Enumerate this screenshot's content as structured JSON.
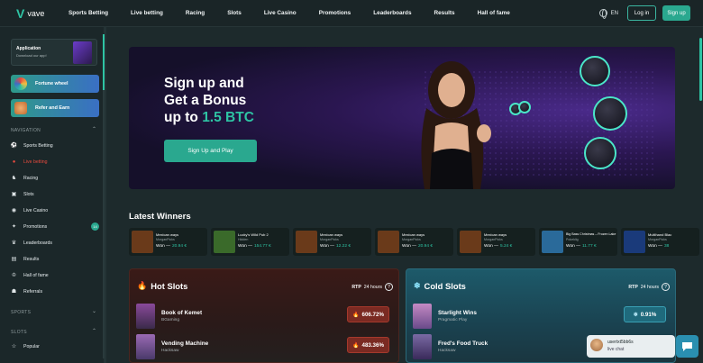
{
  "brand": {
    "name": "vave",
    "accent": "#2ec4a4"
  },
  "nav": [
    "Sports Betting",
    "Live betting",
    "Racing",
    "Slots",
    "Live Casino",
    "Promotions",
    "Leaderboards",
    "Results",
    "Hall of fame"
  ],
  "header": {
    "language": "EN",
    "login_label": "Log in",
    "signup_label": "Sign up"
  },
  "sidebar": {
    "app_title": "Application",
    "app_subtitle": "Download our app!",
    "promo_tiles": [
      "Fortune wheel",
      "Refer and Earn"
    ],
    "nav_label": "NAVIGATION",
    "items": [
      {
        "label": "Sports Betting",
        "icon": "soccer-ball-icon"
      },
      {
        "label": "Live betting",
        "icon": "live-icon"
      },
      {
        "label": "Racing",
        "icon": "horse-icon"
      },
      {
        "label": "Slots",
        "icon": "slot-icon"
      },
      {
        "label": "Live Casino",
        "icon": "chip-icon"
      },
      {
        "label": "Promotions",
        "icon": "gift-icon",
        "badge": "14"
      },
      {
        "label": "Leaderboards",
        "icon": "trophy-icon"
      },
      {
        "label": "Results",
        "icon": "results-icon"
      },
      {
        "label": "Hall of fame",
        "icon": "crown-icon"
      },
      {
        "label": "Referrals",
        "icon": "people-icon"
      }
    ],
    "sports_label": "SPORTS",
    "slots_label": "SLOTS",
    "slots_items": [
      {
        "label": "Popular",
        "icon": "star-icon"
      }
    ]
  },
  "hero": {
    "line1": "Sign up and",
    "line2": "Get a Bonus",
    "line3_prefix": "up to ",
    "line3_accent": "1.5 BTC",
    "button_label": "Sign Up and Play"
  },
  "winners": {
    "title": "Latest Winners",
    "items": [
      {
        "game": "Mexican ways",
        "provider": "MorganPicks",
        "won_label": "Won —",
        "amount": "20.94 €",
        "color": "#6a3a1a"
      },
      {
        "game": "Lucky's Wild Pub 2",
        "provider": "Hidden",
        "won_label": "Won —",
        "amount": "154.77 €",
        "color": "#3a6a2a"
      },
      {
        "game": "Mexican ways",
        "provider": "MorganPicks",
        "won_label": "Won —",
        "amount": "12.22 €",
        "color": "#6a3a1a"
      },
      {
        "game": "Mexican ways",
        "provider": "MorganPicks",
        "won_label": "Won —",
        "amount": "20.94 €",
        "color": "#6a3a1a"
      },
      {
        "game": "Mexican ways",
        "provider": "MorganPicks",
        "won_label": "Won —",
        "amount": "5.24 €",
        "color": "#6a3a1a"
      },
      {
        "game": "Big Bass Christmas – Frozen Lake",
        "provider": "Pokeklig",
        "won_label": "Won —",
        "amount": "11.77 €",
        "color": "#2a6a9a"
      },
      {
        "game": "Multihand Blac",
        "provider": "MorganPicks",
        "won_label": "Won —",
        "amount": "38",
        "color": "#1a3a7a"
      }
    ]
  },
  "hot_slots": {
    "title": "Hot Slots",
    "rtp_label": "RTP",
    "rtp_period": "24 hours",
    "rows": [
      {
        "name": "Book of Kemet",
        "provider": "BGaming",
        "rtp": "606.72%",
        "color": "#5a3a6a"
      },
      {
        "name": "Vending Machine",
        "provider": "Hacksaw",
        "rtp": "483.36%",
        "color": "#6a4a8a"
      }
    ]
  },
  "cold_slots": {
    "title": "Cold Slots",
    "rtp_label": "RTP",
    "rtp_period": "24 hours",
    "rows": [
      {
        "name": "Starlight Wins",
        "provider": "Pragmatic Play",
        "rtp": "0.91%",
        "color": "#8a6aaa"
      },
      {
        "name": "Fred's Food Truck",
        "provider": "Hacksaw",
        "rtp": "",
        "color": "#5a4a7a"
      }
    ]
  },
  "chat": {
    "user": "usertxt5bb6s",
    "subtitle": "live chat"
  }
}
